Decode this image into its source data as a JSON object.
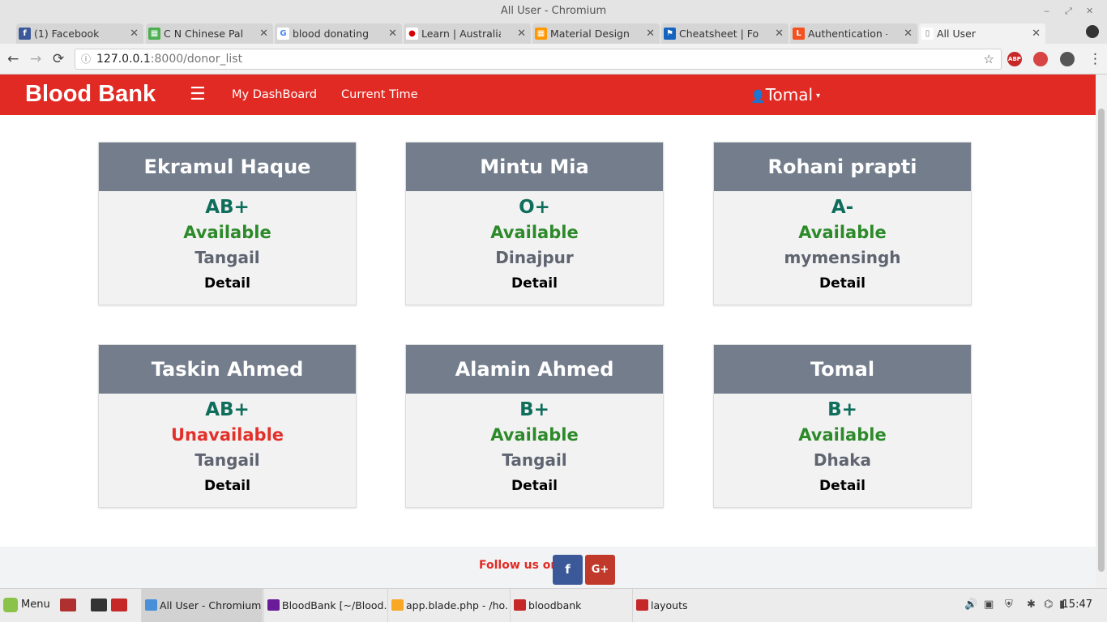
{
  "window": {
    "title": "All User - Chromium",
    "controls": {
      "minimize": "‒",
      "restore": "⤢",
      "close": "✕"
    }
  },
  "tabs": [
    {
      "label": "(1) Facebook",
      "icon": "facebook-icon",
      "color": "#3b5998",
      "glyph": "f"
    },
    {
      "label": "C N Chinese Pale",
      "icon": "palette-icon",
      "color": "#4caf50",
      "glyph": "▦"
    },
    {
      "label": "blood donating sit",
      "icon": "google-icon",
      "color": "#ffffff",
      "glyph": "G"
    },
    {
      "label": "Learn | Australia",
      "icon": "blood-drop-icon",
      "color": "#ffffff",
      "glyph": "●"
    },
    {
      "label": "Material Design C",
      "icon": "material-icon",
      "color": "#ff9800",
      "glyph": "▦"
    },
    {
      "label": "Cheatsheet | Fon",
      "icon": "flag-icon",
      "color": "#1565c0",
      "glyph": "⚑"
    },
    {
      "label": "Authentication - L",
      "icon": "laravel-icon",
      "color": "#f4511e",
      "glyph": "L"
    },
    {
      "label": "All User",
      "icon": "page-icon",
      "color": "#ffffff",
      "glyph": "▯"
    }
  ],
  "tab_close": "✕",
  "toolbar": {
    "back": "←",
    "forward": "→",
    "reload": "⟳",
    "info": "ⓘ",
    "url_host": "127.0.0.1",
    "url_path": ":8000/donor_list",
    "star": "☆",
    "ext_abp": "ABP",
    "menu": "⋮"
  },
  "navbar": {
    "brand": "Blood Bank",
    "menu_icon": "☰",
    "links": [
      "My DashBoard",
      "Current Time"
    ],
    "user": "Tomal",
    "user_icon": "👤",
    "caret": "▾",
    "color": "#e22a24"
  },
  "donors": [
    {
      "name": "Ekramul Haque",
      "blood_group": "AB+",
      "status": "Available",
      "location": "Tangail",
      "detail": "Detail"
    },
    {
      "name": "Mintu Mia",
      "blood_group": "O+",
      "status": "Available",
      "location": "Dinajpur",
      "detail": "Detail"
    },
    {
      "name": "Rohani prapti",
      "blood_group": "A-",
      "status": "Available",
      "location": "mymensingh",
      "detail": "Detail"
    },
    {
      "name": "Taskin Ahmed",
      "blood_group": "AB+",
      "status": "Unavailable",
      "location": "Tangail",
      "detail": "Detail"
    },
    {
      "name": "Alamin Ahmed",
      "blood_group": "B+",
      "status": "Available",
      "location": "Tangail",
      "detail": "Detail"
    },
    {
      "name": "Tomal",
      "blood_group": "B+",
      "status": "Available",
      "location": "Dhaka",
      "detail": "Detail"
    }
  ],
  "colors": {
    "card_header": "#737d8c",
    "blood_group": "#0f6d5c",
    "available": "#2d8a2a",
    "unavailable": "#e2302a"
  },
  "footer": {
    "follow_text": "Follow us on",
    "facebook": "f",
    "google_plus": "G+"
  },
  "taskbar": {
    "menu": "Menu",
    "tasks": [
      {
        "label": "All User - Chromium",
        "icon": "chromium-icon",
        "color": "#4a90d9"
      },
      {
        "label": "BloodBank [~/Blood...",
        "icon": "phpstorm-icon",
        "color": "#6a1b9a"
      },
      {
        "label": "app.blade.php - /ho...",
        "icon": "editor-icon",
        "color": "#f9a825"
      },
      {
        "label": "bloodbank",
        "icon": "folder-icon",
        "color": "#c62828"
      },
      {
        "label": "layouts",
        "icon": "folder-icon",
        "color": "#c62828"
      }
    ],
    "tray": [
      "🔊",
      "▣",
      "⛨",
      "✱",
      "⌬",
      "▮"
    ],
    "clock": "15:47"
  }
}
